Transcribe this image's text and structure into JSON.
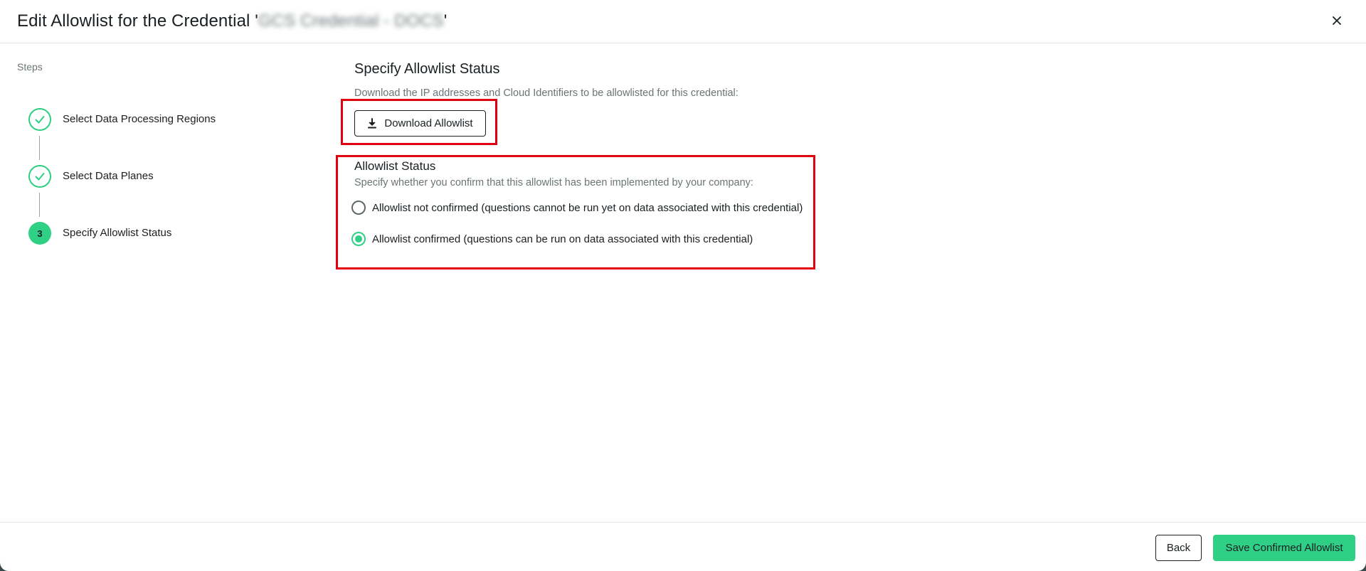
{
  "dialog": {
    "title_prefix": "Edit Allowlist for the Credential '",
    "credential_name": "GCS Credential - DOCS",
    "title_suffix": "'",
    "close_icon": "close-icon"
  },
  "sidebar": {
    "steps_label": "Steps",
    "steps": [
      {
        "label": "Select Data Processing Regions",
        "state": "done",
        "icon": "check-icon"
      },
      {
        "label": "Select Data Planes",
        "state": "done",
        "icon": "check-icon"
      },
      {
        "label": "Specify Allowlist Status",
        "state": "current",
        "number": "3"
      }
    ]
  },
  "main": {
    "title": "Specify Allowlist Status",
    "description": "Download the IP addresses and Cloud Identifiers to be allowlisted for this credential:",
    "download_button": {
      "label": "Download Allowlist",
      "icon": "download-icon"
    },
    "status": {
      "title": "Allowlist Status",
      "description": "Specify whether you confirm that this allowlist has been implemented by your company:",
      "options": [
        {
          "label": "Allowlist not confirmed (questions cannot be run yet on data associated with this credential)",
          "selected": false
        },
        {
          "label": "Allowlist confirmed (questions can be run on data associated with this credential)",
          "selected": true
        }
      ]
    }
  },
  "footer": {
    "back_label": "Back",
    "save_label": "Save Confirmed Allowlist"
  },
  "colors": {
    "accent": "#2fcf86",
    "highlight": "#e0000f",
    "text": "#1a1f22",
    "muted": "#6b7475"
  }
}
